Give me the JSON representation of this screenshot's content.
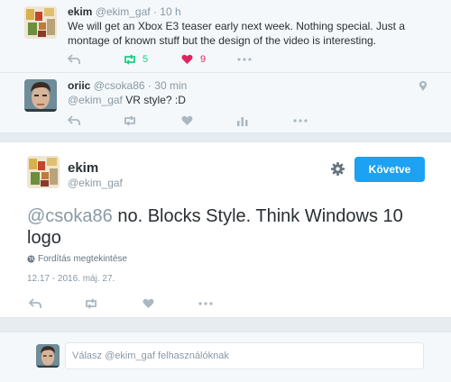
{
  "tweets": [
    {
      "name": "ekim",
      "handle": "@ekim_gaf",
      "separator": "·",
      "time": "10 h",
      "text": "We will get an Xbox E3 teaser early next week. Nothing special. Just a montage of known stuff but the design of the video is interesting.",
      "retweet_count": "5",
      "like_count": "9"
    },
    {
      "name": "oriic",
      "handle": "@csoka86",
      "separator": "·",
      "time": "30 min",
      "text_mention": "@ekim_gaf",
      "text": " VR style? :D"
    }
  ],
  "main_tweet": {
    "name": "ekim",
    "handle": "@ekim_gaf",
    "follow_label": "Követve",
    "text_mention": "@csoka86",
    "text": " no. Blocks Style. Think Windows 10 logo",
    "translate_label": "Fordítás megtekintése",
    "datetime": "12.17 - 2016. máj. 27."
  },
  "reply": {
    "prefix": "Válasz ",
    "mention": "@ekim_gaf",
    "suffix": " felhasználóknak"
  },
  "colors": {
    "accent": "#1da1f2",
    "retweet": "#19cf86",
    "like": "#e0245e",
    "icon_gray": "#aab8c2"
  },
  "icons": [
    "reply-icon",
    "retweet-icon",
    "heart-icon",
    "more-icon",
    "analytics-icon",
    "location-pin-icon",
    "gear-icon",
    "globe-icon"
  ]
}
